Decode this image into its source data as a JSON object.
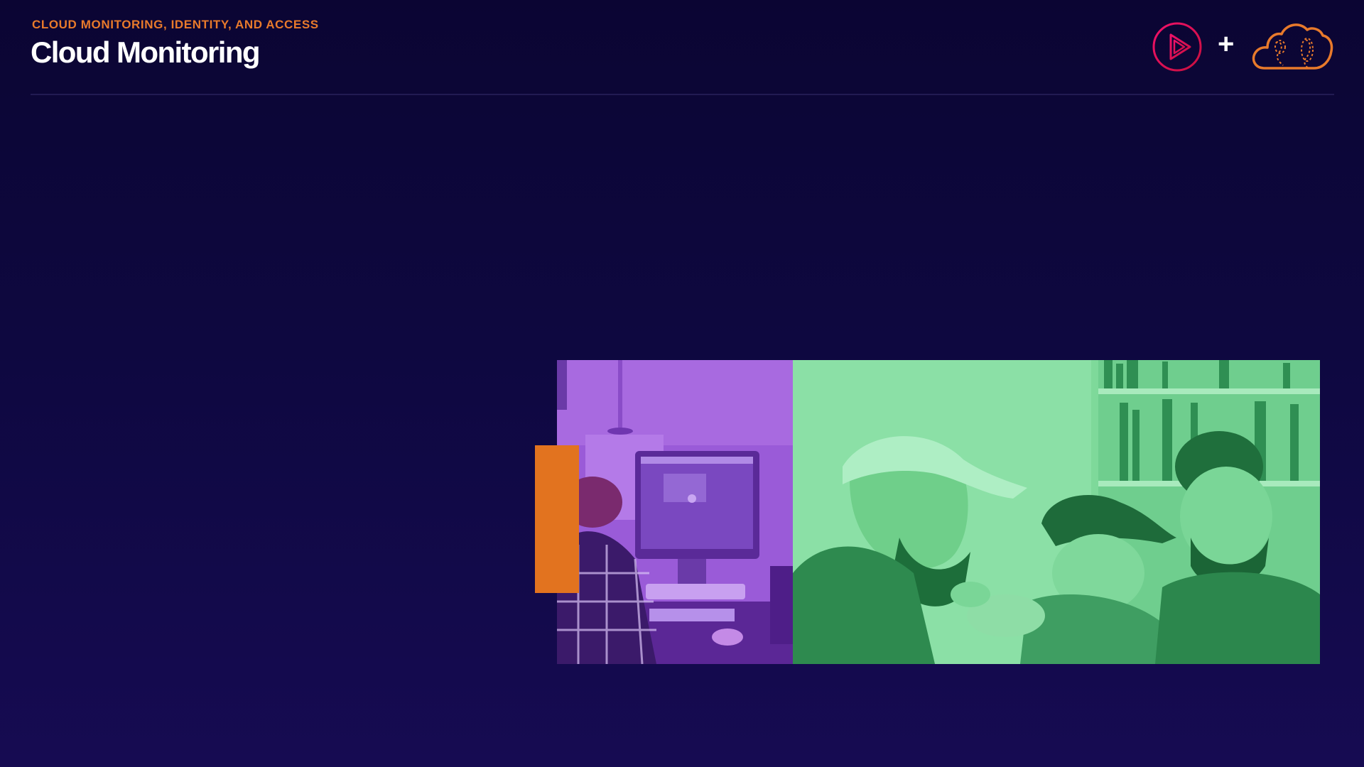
{
  "header": {
    "eyebrow": "CLOUD MONITORING, IDENTITY, AND ACCESS",
    "title": "Cloud Monitoring"
  },
  "brand": {
    "play_logo_icon": "play-triangle-icon",
    "plus": "+",
    "cloud_logo_icon": "cloud-icon"
  },
  "photos": {
    "left_scene": "person-at-computer-photo",
    "right_scene": "group-laughing-photo"
  },
  "colors": {
    "background_top": "#0b0533",
    "background_bottom": "#160b52",
    "accent_orange": "#e2731f",
    "eyebrow_orange": "#e87a2b",
    "photo_left_tint": "#9a5bd8",
    "photo_right_tint": "#6fd38e",
    "play_logo": "#e0115f"
  }
}
